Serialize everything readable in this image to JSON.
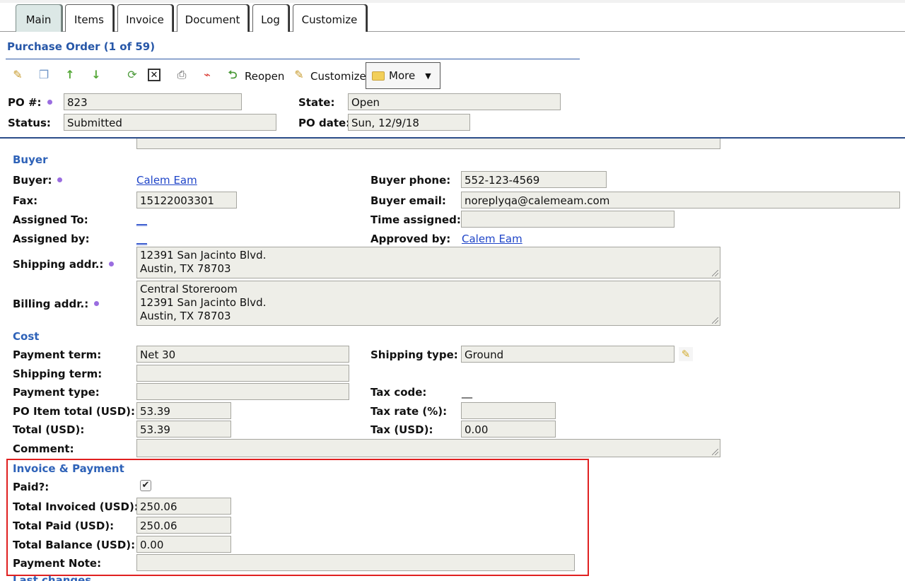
{
  "tabs": [
    "Main",
    "Items",
    "Invoice",
    "Document",
    "Log",
    "Customize"
  ],
  "header": {
    "title": "Purchase Order (1 of 59)"
  },
  "toolbar": {
    "icons": [
      "edit-icon",
      "copy-icon",
      "up-arrow-icon",
      "down-arrow-icon",
      "refresh-icon",
      "delete-icon",
      "print-icon",
      "pdf-icon",
      "reopen-icon",
      "customize-icon",
      "folder-icon"
    ],
    "reopen_label": "Reopen",
    "customize_label": "Customize",
    "more_label": "More"
  },
  "summary": {
    "po_label": "PO #:",
    "po_value": "823",
    "state_label": "State:",
    "state_value": "Open",
    "status_label": "Status:",
    "status_value": "Submitted",
    "po_date_label": "PO date:",
    "po_date_value": "Sun, 12/9/18"
  },
  "buyer": {
    "section": "Buyer",
    "buyer_label": "Buyer:",
    "buyer_value": "Calem Eam",
    "buyer_phone_label": "Buyer phone:",
    "buyer_phone_value": "552-123-4569",
    "fax_label": "Fax:",
    "fax_value": "15122003301",
    "buyer_email_label": "Buyer email:",
    "buyer_email_value": "noreplyqa@calemeam.com",
    "assigned_to_label": "Assigned To:",
    "assigned_to_value": "__",
    "time_assigned_label": "Time assigned:",
    "time_assigned_value": "",
    "assigned_by_label": "Assigned by:",
    "assigned_by_value": "__",
    "approved_by_label": "Approved by:",
    "approved_by_value": "Calem Eam",
    "shipping_addr_label": "Shipping addr.:",
    "shipping_addr_value": "12391 San Jacinto Blvd.\nAustin, TX 78703",
    "billing_addr_label": "Billing addr.:",
    "billing_addr_value": "Central Storeroom\n12391 San Jacinto Blvd.\nAustin, TX 78703"
  },
  "cost": {
    "section": "Cost",
    "payment_term_label": "Payment term:",
    "payment_term_value": "Net 30",
    "shipping_type_label": "Shipping type:",
    "shipping_type_value": "Ground",
    "shipping_term_label": "Shipping term:",
    "shipping_term_value": "",
    "payment_type_label": "Payment type:",
    "payment_type_value": "",
    "tax_code_label": "Tax code:",
    "tax_code_value": "__",
    "po_item_total_label": "PO Item total (USD):",
    "po_item_total_value": "53.39",
    "tax_rate_label": "Tax rate (%):",
    "tax_rate_value": "",
    "total_label": "Total (USD):",
    "total_value": "53.39",
    "tax_label": "Tax (USD):",
    "tax_value": "0.00",
    "comment_label": "Comment:",
    "comment_value": ""
  },
  "invoice": {
    "section": "Invoice & Payment",
    "paid_label": "Paid?:",
    "paid_checked": true,
    "paid_mark": "✔",
    "total_invoiced_label": "Total Invoiced (USD):",
    "total_invoiced_value": "250.06",
    "total_paid_label": "Total Paid (USD):",
    "total_paid_value": "250.06",
    "total_balance_label": "Total Balance (USD):",
    "total_balance_value": "0.00",
    "payment_note_label": "Payment Note:",
    "payment_note_value": ""
  },
  "footer": {
    "next_section": "Last changes"
  },
  "colors": {
    "section_blue": "#2e62b8",
    "title_blue": "#2757a8",
    "link_blue": "#1f45c8",
    "highlight_red": "#e02020",
    "field_bg": "#eeeee8",
    "required_dot": "#9a6de0"
  }
}
